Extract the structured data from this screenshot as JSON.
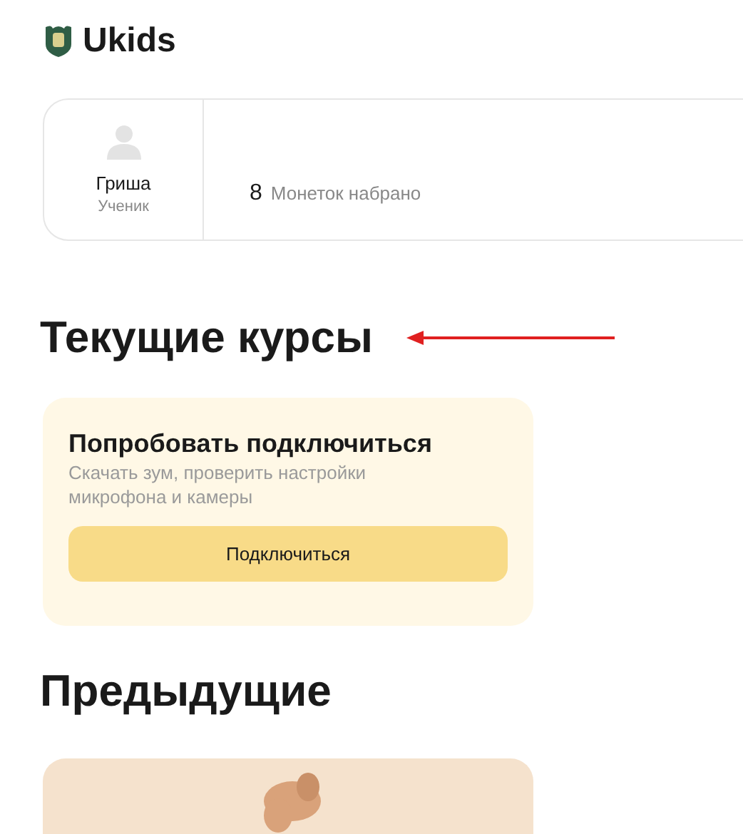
{
  "header": {
    "logo_text": "Ukids"
  },
  "profile": {
    "name": "Гриша",
    "role": "Ученик",
    "coins": "8",
    "coins_label": "Монеток набрано"
  },
  "current_courses": {
    "title": "Текущие курсы",
    "cards": [
      {
        "title": "Попробовать подключиться",
        "description": "Скачать зум, проверить настройки микрофона и камеры",
        "button": "Подключиться"
      }
    ]
  },
  "previous": {
    "title": "Предыдущие"
  }
}
